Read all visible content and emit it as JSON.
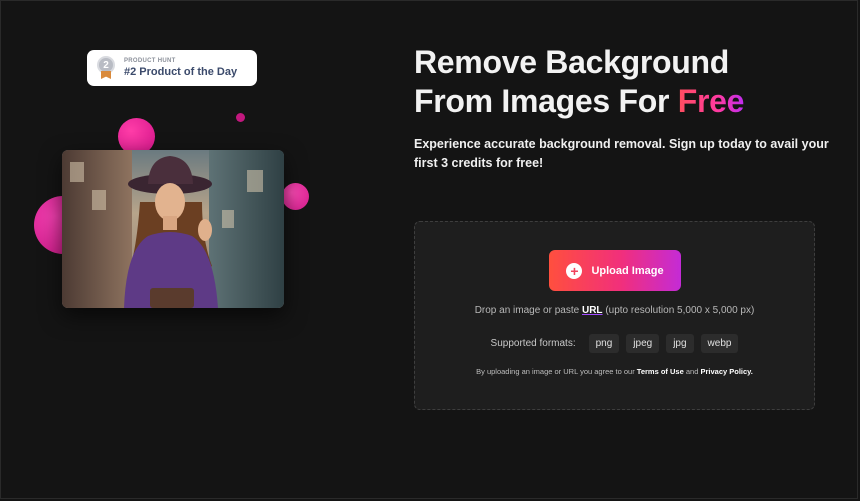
{
  "badge": {
    "label_small": "PRODUCT HUNT",
    "label_main": "#2 Product of the Day",
    "medal_number": "2"
  },
  "hero": {
    "title_part1": "Remove Background",
    "title_part2": "From Images For",
    "title_highlight": "Free",
    "subtitle": "Experience accurate background removal. Sign up today to avail your first 3 credits for free!"
  },
  "upload": {
    "button_label": "Upload Image",
    "drop_text_before": "Drop an image or paste",
    "drop_link": "URL",
    "drop_text_after": "(upto resolution 5,000 x 5,000 px)",
    "formats_label": "Supported formats:",
    "formats": [
      "png",
      "jpeg",
      "jpg",
      "webp"
    ],
    "terms_before": "By uploading an image or URL you agree to our",
    "terms_link": "Terms of Use",
    "terms_and": "and",
    "privacy_link": "Privacy Policy."
  },
  "colors": {
    "background": "#141414",
    "accent_start": "#ff4f3e",
    "accent_end": "#c42bd6",
    "blob": "#d4148a"
  }
}
